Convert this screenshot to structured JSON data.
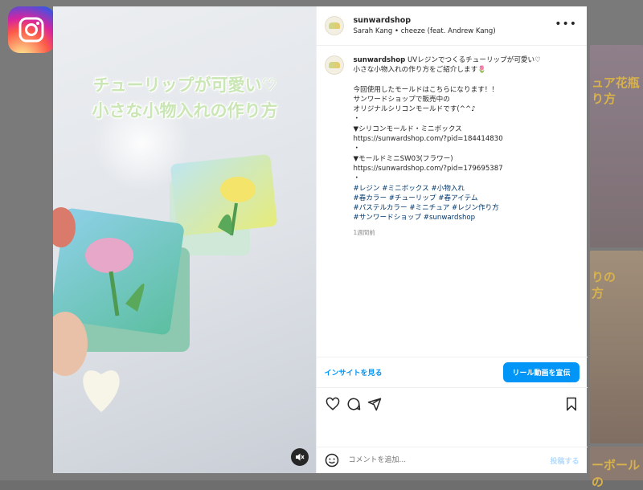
{
  "app": {
    "logo": "instagram-logo"
  },
  "backdrop": {
    "texts": [
      "ュア花瓶",
      "り方",
      "りの",
      "方",
      "ーボールの"
    ]
  },
  "media": {
    "overlay_title_line1": "チューリップが可愛い♡",
    "overlay_title_line2": "小さな小物入れの作り方",
    "mute_icon": "speaker-muted-icon"
  },
  "header": {
    "username": "sunwardshop",
    "audio": "Sarah Kang • cheeze (feat. Andrew Kang)",
    "more_icon": "more-horizontal-icon"
  },
  "caption": {
    "username": "sunwardshop",
    "lines": [
      "UVレジンでつくるチューリップが可愛い♡",
      "小さな小物入れの作り方をご紹介します🌷",
      "",
      "今回使用したモールドはこちらになります！！",
      "サンワードショップで販売中の",
      "オリジナルシリコンモールドです(^^♪",
      "・",
      "▼シリコンモールド・ミニボックス",
      "https://sunwardshop.com/?pid=184414830",
      "・",
      "▼モールドミニSW03(フラワー)",
      "https://sunwardshop.com/?pid=179695387",
      "・"
    ],
    "hashtags": [
      "#レジン #ミニボックス #小物入れ",
      "#春カラー #チューリップ #春アイテム",
      "#パステルカラー #ミニチュア #レジン作り方",
      "#サンワードショップ #sunwardshop"
    ],
    "time": "1週間前"
  },
  "insights": {
    "link": "インサイトを見る",
    "boost_button": "リール動画を宣伝"
  },
  "actions": {
    "icons": [
      "heart-icon",
      "comment-icon",
      "share-icon",
      "bookmark-icon"
    ]
  },
  "comment": {
    "placeholder": "コメントを追加...",
    "post": "投稿する",
    "emoji_icon": "emoji-icon"
  },
  "colors": {
    "accent": "#0095f6",
    "link": "#00376b",
    "muted": "#8e8e8e"
  }
}
